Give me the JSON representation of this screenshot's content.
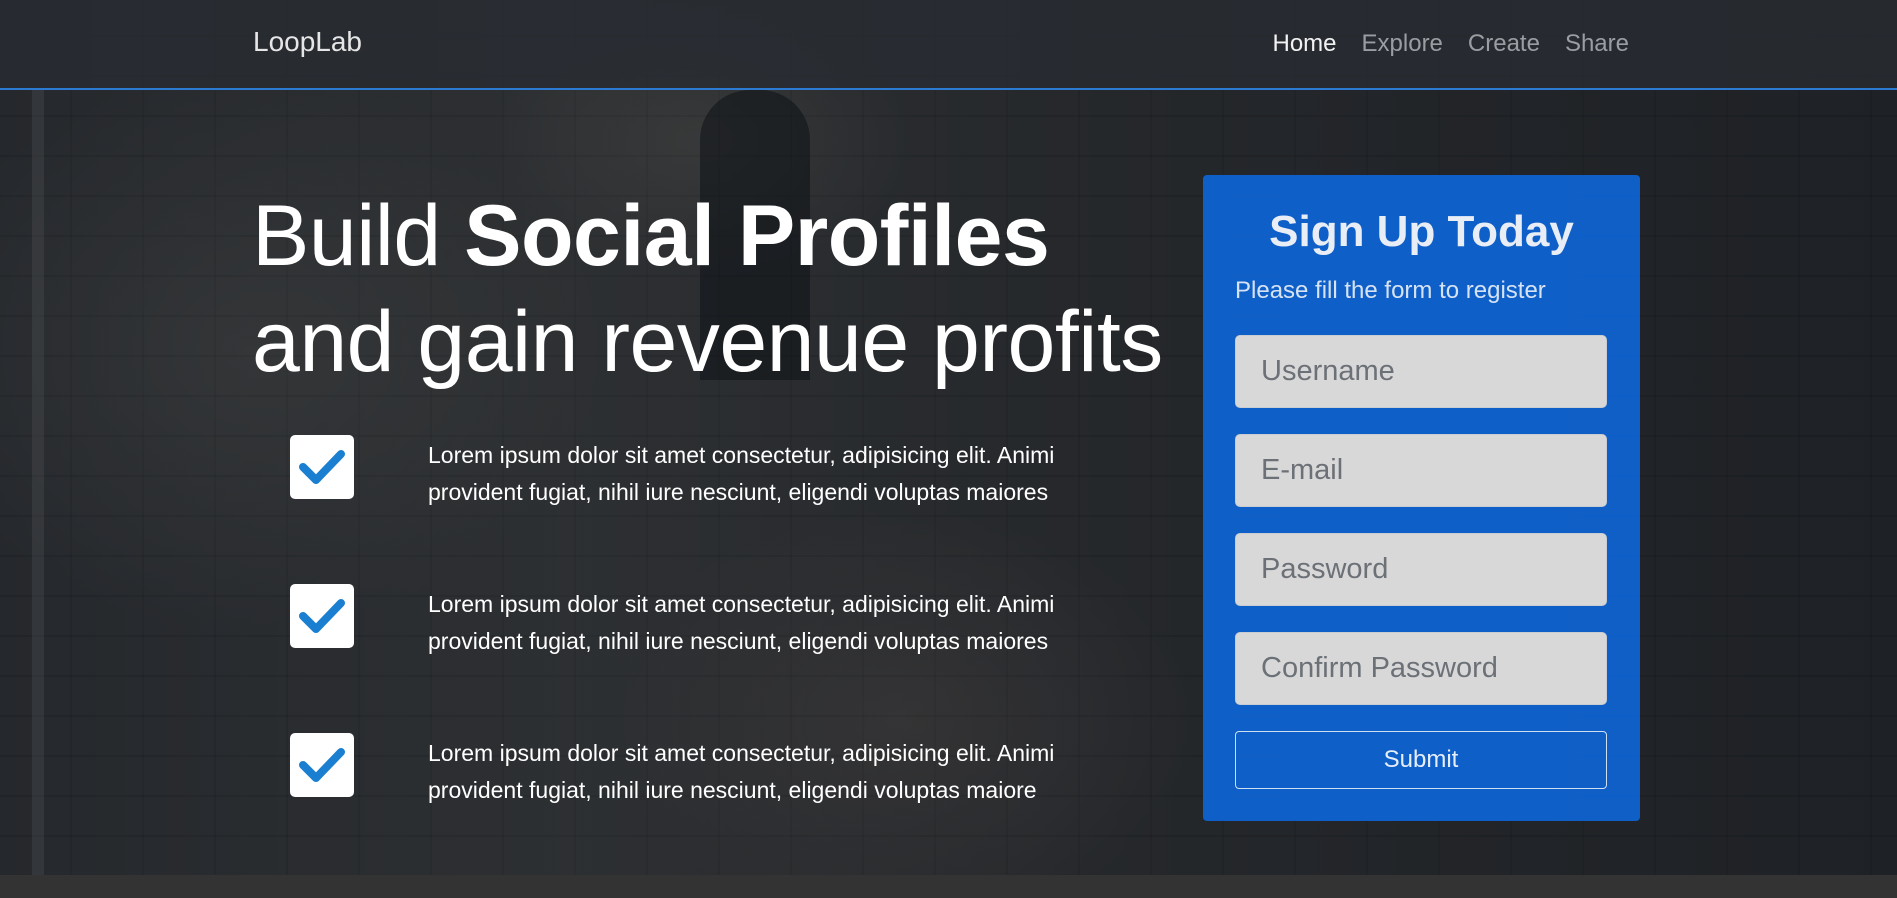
{
  "navbar": {
    "brand": "LoopLab",
    "items": [
      {
        "label": "Home",
        "active": true
      },
      {
        "label": "Explore",
        "active": false
      },
      {
        "label": "Create",
        "active": false
      },
      {
        "label": "Share",
        "active": false
      }
    ],
    "accent_color": "#2a7bd1"
  },
  "hero": {
    "headline_part1": "Build ",
    "headline_bold": "Social Profiles",
    "headline_part2": " and gain revenue profits",
    "features": [
      {
        "icon": "check-icon",
        "text": "Lorem ipsum dolor sit amet consectetur, adipisicing elit. Animi provident fugiat, nihil iure nesciunt, eligendi voluptas maiores"
      },
      {
        "icon": "check-icon",
        "text": "Lorem ipsum dolor sit amet consectetur, adipisicing elit. Animi provident fugiat, nihil iure nesciunt, eligendi voluptas maiores"
      },
      {
        "icon": "check-icon",
        "text": "Lorem ipsum dolor sit amet consectetur, adipisicing elit. Animi provident fugiat, nihil iure nesciunt, eligendi voluptas maiore"
      }
    ],
    "check_color": "#1a7fd0"
  },
  "signup": {
    "title": "Sign Up Today",
    "subtitle": "Please fill the form to register",
    "username_placeholder": "Username",
    "email_placeholder": "E-mail",
    "password_placeholder": "Password",
    "confirm_placeholder": "Confirm Password",
    "submit_label": "Submit",
    "card_color": "#0d68de"
  }
}
